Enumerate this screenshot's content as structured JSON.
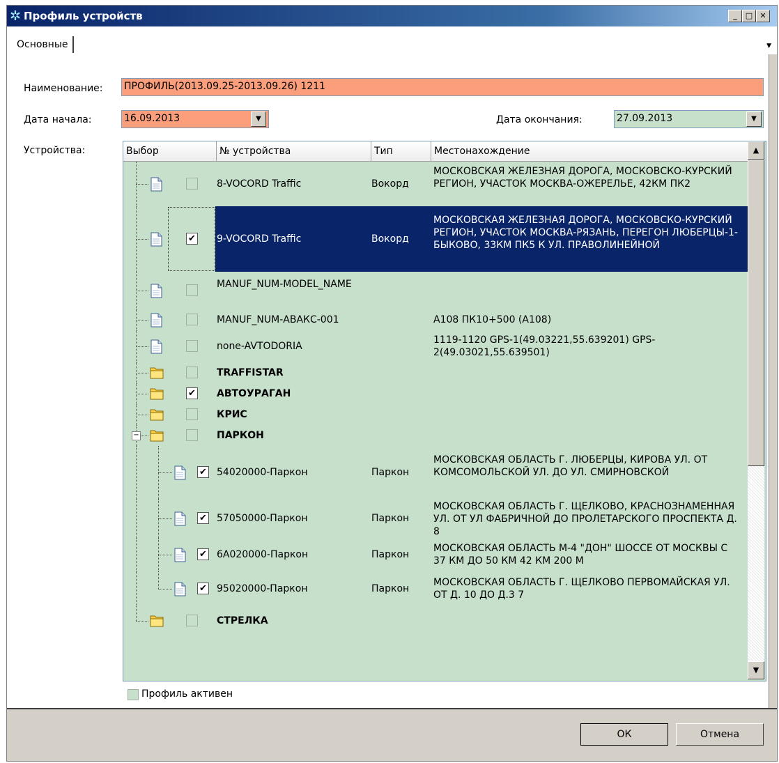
{
  "window": {
    "title": "Профиль устройств"
  },
  "tabs": [
    {
      "label": "Основные"
    }
  ],
  "form": {
    "name_label": "Наименование:",
    "name_value": "ПРОФИЛЬ(2013.09.25-2013.09.26) 1211",
    "start_label": "Дата начала:",
    "start_value": "16.09.2013",
    "end_label": "Дата окончания:",
    "end_value": "27.09.2013",
    "devices_label": "Устройства:"
  },
  "grid": {
    "columns": [
      "Выбор",
      "№ устройства",
      "Тип",
      "Местонахождение"
    ],
    "rows": [
      {
        "kind": "device",
        "checked": false,
        "number": "8-VOCORD Traffic",
        "type": "Вокорд",
        "location": "МОСКОВСКАЯ ЖЕЛЕЗНАЯ ДОРОГА, МОСКОВСКО-КУРСКИЙ РЕГИОН, УЧАСТОК МОСКВА-ОЖЕРЕЛЬЕ, 42КМ ПК2"
      },
      {
        "kind": "device",
        "checked": true,
        "selected": true,
        "number": "9-VOCORD Traffic",
        "type": "Вокорд",
        "location": "МОСКОВСКАЯ ЖЕЛЕЗНАЯ ДОРОГА, МОСКОВСКО-КУРСКИЙ РЕГИОН, УЧАСТОК МОСКВА-РЯЗАНЬ, ПЕРЕГОН ЛЮБЕРЦЫ-1-БЫКОВО, 33КМ ПК5 К УЛ. ПРАВОЛИНЕЙНОЙ"
      },
      {
        "kind": "device",
        "checked": false,
        "number": "MANUF_NUM-MODEL_NAME",
        "type": "",
        "location": ""
      },
      {
        "kind": "device",
        "checked": false,
        "number": "MANUF_NUM-АВАКС-001",
        "type": "",
        "location": "А108 ПК10+500 (А108)"
      },
      {
        "kind": "device",
        "checked": false,
        "number": "none-AVTODORIA",
        "type": "",
        "location": "1119-1120 GPS-1(49.03221,55.639201) GPS-2(49.03021,55.639501)"
      },
      {
        "kind": "group",
        "checked": false,
        "number": "TRAFFISTAR"
      },
      {
        "kind": "group",
        "checked": true,
        "number": "АВТОУРАГАН"
      },
      {
        "kind": "group",
        "checked": false,
        "number": "КРИС"
      },
      {
        "kind": "group",
        "checked": false,
        "expanded": true,
        "number": "ПАРКОН"
      },
      {
        "kind": "child",
        "checked": true,
        "number": "54020000-Паркон",
        "type": "Паркон",
        "location": "МОСКОВСКАЯ ОБЛАСТЬ Г. ЛЮБЕРЦЫ, КИРОВА УЛ. ОТ КОМСОМОЛЬСКОЙ УЛ. ДО УЛ. СМИРНОВСКОЙ"
      },
      {
        "kind": "child",
        "checked": true,
        "number": "57050000-Паркон",
        "type": "Паркон",
        "location": "МОСКОВСКАЯ ОБЛАСТЬ Г. ЩЕЛКОВО, КРАСНОЗНАМЕННАЯ УЛ. ОТ УЛ ФАБРИЧНОЙ ДО ПРОЛЕТАРСКОГО ПРОСПЕКТА Д. 8"
      },
      {
        "kind": "child",
        "checked": true,
        "number": "6А020000-Паркон",
        "type": "Паркон",
        "location": "МОСКОВСКАЯ ОБЛАСТЬ М-4 \"ДОН\"  ШОССЕ ОТ МОСКВЫ С 37 КМ ДО 50 КМ 42 КМ 200 М"
      },
      {
        "kind": "child",
        "checked": true,
        "number": "95020000-Паркон",
        "type": "Паркон",
        "location": "МОСКОВСКАЯ ОБЛАСТЬ Г. ЩЕЛКОВО ПЕРВОМАЙСКАЯ УЛ. ОТ Д. 10 ДО Д.3 7"
      },
      {
        "kind": "group",
        "checked": false,
        "last": true,
        "number": "СТРЕЛКА"
      }
    ]
  },
  "active_label": "Профиль активен",
  "active_checked": false,
  "buttons": {
    "ok": "ОК",
    "cancel": "Отмена"
  },
  "colors": {
    "required": "#fa9e7b",
    "optional": "#c7e0cc",
    "selection": "#0a246a"
  }
}
